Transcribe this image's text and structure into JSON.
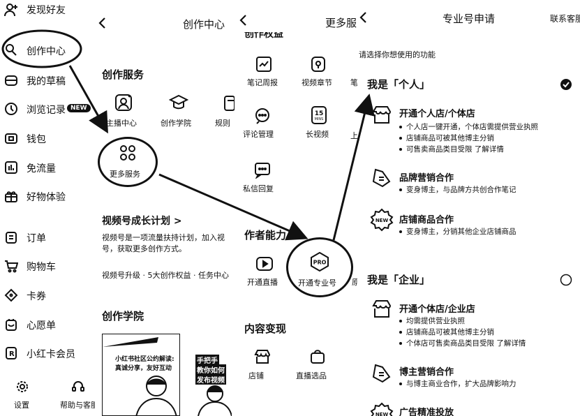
{
  "sidebar": {
    "items": [
      {
        "label": "发现好友",
        "icon": "add-user-icon"
      },
      {
        "label": "创作中心",
        "icon": "creator-center-icon"
      },
      {
        "label": "我的草稿",
        "icon": "draft-icon"
      },
      {
        "label": "浏览记录",
        "icon": "history-icon",
        "badge": "NEW"
      },
      {
        "label": "钱包",
        "icon": "wallet-icon"
      },
      {
        "label": "免流量",
        "icon": "data-free-icon"
      },
      {
        "label": "好物体验",
        "icon": "gift-icon"
      },
      {
        "label": "订单",
        "icon": "order-icon"
      },
      {
        "label": "购物车",
        "icon": "cart-icon"
      },
      {
        "label": "卡券",
        "icon": "coupon-icon"
      },
      {
        "label": "心愿单",
        "icon": "wishlist-icon"
      },
      {
        "label": "小红卡会员",
        "icon": "member-card-icon"
      }
    ],
    "bottom": [
      {
        "label": "设置",
        "icon": "settings-icon"
      },
      {
        "label": "帮助与客服",
        "icon": "help-icon"
      }
    ]
  },
  "creator": {
    "title": "创作中心",
    "services_heading": "创作服务",
    "services": [
      {
        "label": "主播中心",
        "icon": "anchor-center-icon"
      },
      {
        "label": "创作学院",
        "icon": "academy-icon"
      },
      {
        "label": "规则",
        "icon": "rules-icon"
      }
    ],
    "more_services": "更多服务",
    "growth_title": "视频号成长计划 >",
    "growth_desc_1": "视频号是一项流量扶持计划，加入视",
    "growth_desc_2": "号，获取更多创作方式。",
    "growth_tags": "视频号升级 · 5大创作权益 · 任务中心",
    "academy_heading": "创作学院",
    "banner_text_1": "小红书社区公约解读:",
    "banner_text_2": "真诚分享，友好互动",
    "banner_text_3": "手把手",
    "banner_text_4": "教你如何",
    "banner_text_5": "发布视频"
  },
  "more": {
    "title": "更多服",
    "section_top": "创作权益",
    "row1": [
      {
        "label": "笔记周报",
        "icon": "weekly-report-icon"
      },
      {
        "label": "视频章节",
        "icon": "video-chapter-icon"
      },
      {
        "label": "笔",
        "icon": "note-icon"
      }
    ],
    "row2": [
      {
        "label": "评论管理",
        "icon": "comment-manage-icon"
      },
      {
        "label": "长视频",
        "icon": "long-video-icon",
        "badge": "15 MINS"
      },
      {
        "label": "上",
        "icon": "upload-icon"
      }
    ],
    "row3": [
      {
        "label": "私信回复",
        "icon": "dm-reply-icon"
      }
    ],
    "section_ability": "作者能力",
    "row4": [
      {
        "label": "开通直播",
        "icon": "live-icon"
      },
      {
        "label": "开通专业号",
        "icon": "pro-icon",
        "badge": "PRO"
      },
      {
        "label": "原",
        "icon": "original-icon"
      }
    ],
    "section_monetize": "内容变现",
    "row5": [
      {
        "label": "店铺",
        "icon": "shop-icon"
      },
      {
        "label": "直播选品",
        "icon": "live-selection-icon"
      }
    ]
  },
  "pro": {
    "title": "专业号申请",
    "contact": "联系客服",
    "prompt": "请选择你想使用的功能",
    "personal_heading": "我是「个人」",
    "personal_items": [
      {
        "title": "开通个人店/个体店",
        "icon": "store-icon",
        "bullets": [
          "个人店一键开通，个体店需提供营业执照",
          "店铺商品可被其他博主分销",
          "可售卖商品类目受限 了解详情"
        ]
      },
      {
        "title": "品牌营销合作",
        "icon": "brand-icon",
        "bullets": [
          "变身博主，与品牌方共创合作笔记"
        ]
      },
      {
        "title": "店铺商品合作",
        "icon": "new-badge-icon",
        "badge": "NEW",
        "bullets": [
          "变身博主，分销其他企业店铺商品"
        ]
      }
    ],
    "enterprise_heading": "我是「企业」",
    "enterprise_items": [
      {
        "title": "开通个体店/企业店",
        "icon": "store-icon",
        "bullets": [
          "均需提供营业执照",
          "店铺商品可被其他博主分销",
          "个体店可售卖商品类目受限 了解详情"
        ]
      },
      {
        "title": "博主营销合作",
        "icon": "brand-icon",
        "bullets": [
          "与博主商业合作，扩大品牌影响力"
        ]
      },
      {
        "title": "广告精准投放",
        "icon": "new-badge-icon",
        "badge": "NEW",
        "bullets": []
      }
    ]
  }
}
